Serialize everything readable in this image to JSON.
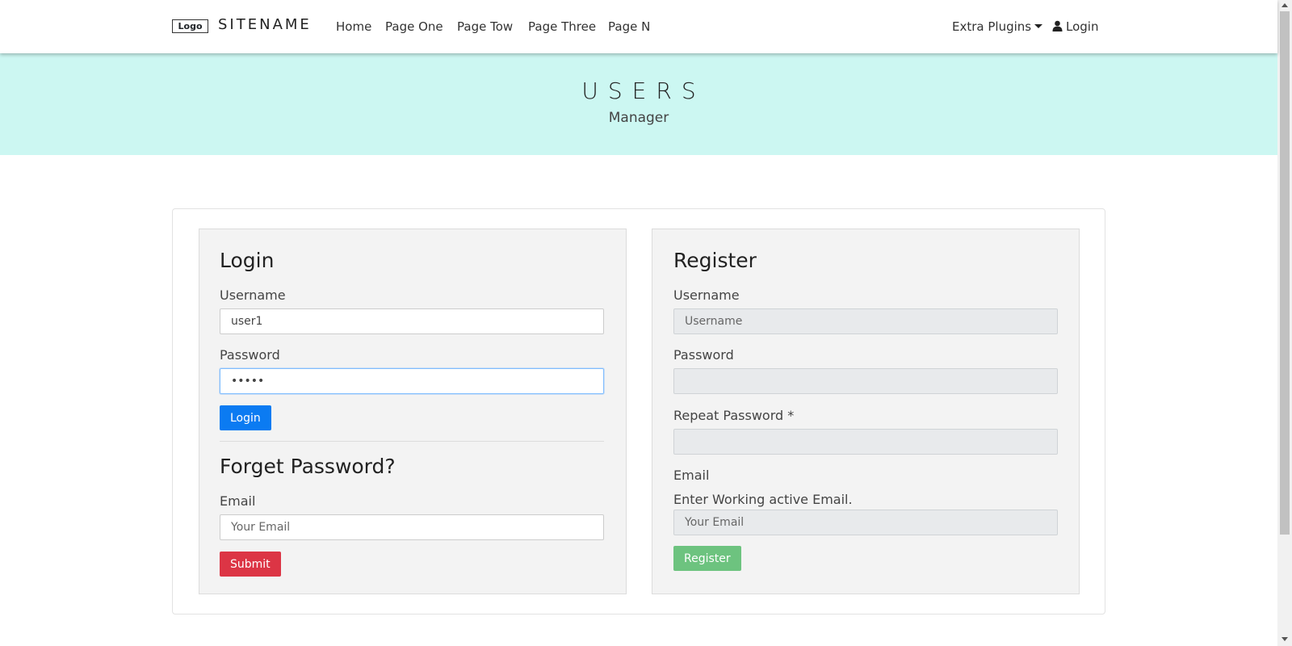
{
  "navbar": {
    "logo": "Logo",
    "sitename": "SITENAME",
    "links": [
      "Home",
      "Page One",
      "Page Tow",
      "Page Three",
      "Page N"
    ],
    "extra_plugins": "Extra Plugins",
    "login": "Login",
    "icons": {
      "dropdown": "caret-down-icon",
      "user": "user-icon"
    }
  },
  "hero": {
    "title": "USERS",
    "subtitle": "Manager",
    "background": "#ccf7f2"
  },
  "login_panel": {
    "title": "Login",
    "username_label": "Username",
    "username_value": "user1",
    "password_label": "Password",
    "password_value": "•••••",
    "button": "Login"
  },
  "forgot_panel": {
    "title": "Forget Password?",
    "email_label": "Email",
    "email_placeholder": "Your Email",
    "button": "Submit"
  },
  "register_panel": {
    "title": "Register",
    "username_label": "Username",
    "username_placeholder": "Username",
    "password_label": "Password",
    "repeat_password_label": "Repeat Password *",
    "email_label": "Email",
    "email_help": "Enter Working active Email.",
    "email_placeholder": "Your Email",
    "button": "Register"
  },
  "colors": {
    "primary": "#0b7bf2",
    "danger": "#dc3545",
    "success": "#6dc37f"
  }
}
